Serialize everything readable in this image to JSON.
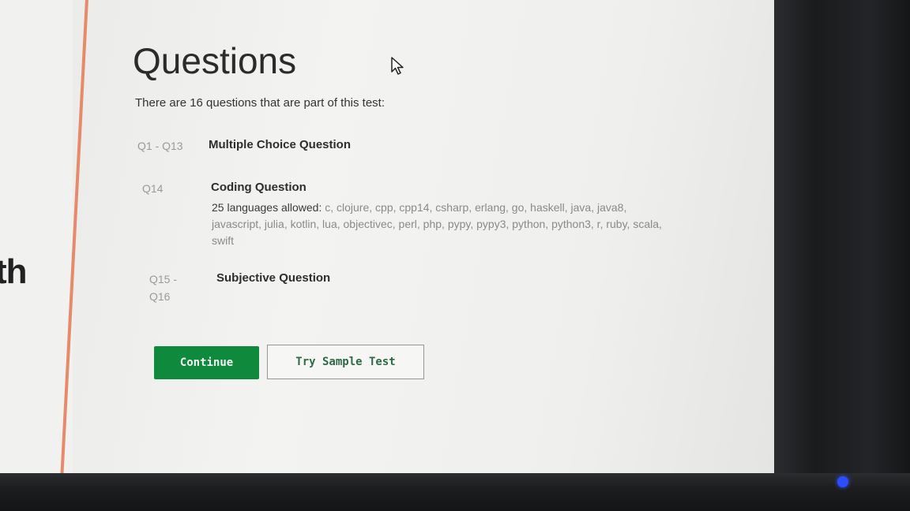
{
  "side_panel": {
    "partial_text": "th"
  },
  "page": {
    "title": "Questions",
    "intro": "There are 16 questions that are part of this test:"
  },
  "questions": [
    {
      "range": "Q1 - Q13",
      "type": "Multiple Choice Question",
      "desc_lead": "",
      "desc_rest": ""
    },
    {
      "range": "Q14",
      "type": "Coding Question",
      "desc_lead": "25 languages allowed:",
      "desc_rest": " c, clojure, cpp, cpp14, csharp, erlang, go, haskell, java, java8, javascript, julia, kotlin, lua, objectivec, perl, php, pypy, pypy3, python, python3, r, ruby, scala, swift"
    },
    {
      "range_line1": "Q15 -",
      "range_line2": "Q16",
      "type": "Subjective Question"
    }
  ],
  "actions": {
    "continue_label": "Continue",
    "sample_label": "Try Sample Test"
  },
  "colors": {
    "accent_green": "#0f8a3d",
    "border_orange": "#e58a6a",
    "power_led": "#2d4cff"
  },
  "icons": {
    "cursor": "mouse-pointer-icon"
  }
}
